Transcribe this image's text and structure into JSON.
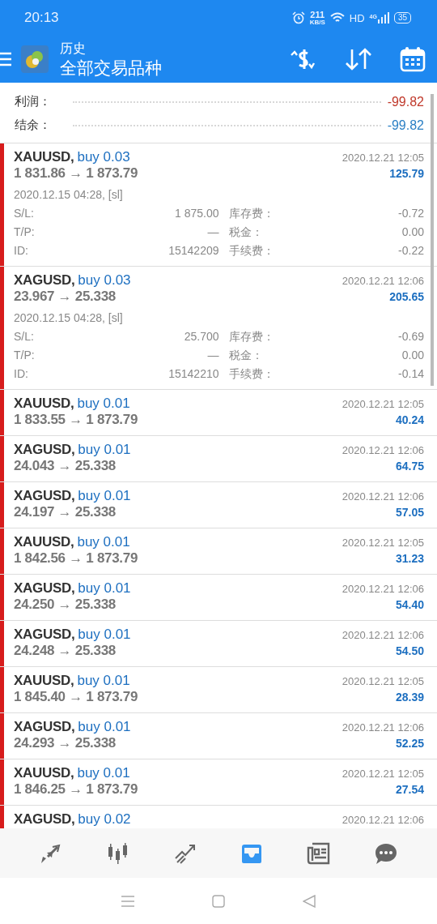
{
  "status_bar": {
    "time": "20:13",
    "speed": "211",
    "speed_unit": "KB/S",
    "hd": "HD",
    "network": "4G",
    "battery": "35"
  },
  "header": {
    "title": "历史",
    "subtitle": "全部交易品种"
  },
  "summary": [
    {
      "label": "利润：",
      "value": "-99.82",
      "color": "#c0392b"
    },
    {
      "label": "结余：",
      "value": "-99.82",
      "color": "#2a7fc4"
    }
  ],
  "trades": [
    {
      "symbol": "XAUUSD,",
      "action": "buy 0.03",
      "time": "2020.12.21 12:05",
      "prices": "1 831.86 → 1 873.79",
      "profit": "125.79",
      "open_info": "2020.12.15 04:28, [sl]",
      "details": [
        [
          "S/L:",
          "1 875.00",
          "库存费：",
          "-0.72"
        ],
        [
          "T/P:",
          "—",
          "税金：",
          "0.00"
        ],
        [
          "ID:",
          "15142209",
          "手续费：",
          "-0.22"
        ]
      ]
    },
    {
      "symbol": "XAGUSD,",
      "action": "buy 0.03",
      "time": "2020.12.21 12:06",
      "prices": "23.967 → 25.338",
      "profit": "205.65",
      "open_info": "2020.12.15 04:28, [sl]",
      "details": [
        [
          "S/L:",
          "25.700",
          "库存费：",
          "-0.69"
        ],
        [
          "T/P:",
          "—",
          "税金：",
          "0.00"
        ],
        [
          "ID:",
          "15142210",
          "手续费：",
          "-0.14"
        ]
      ]
    },
    {
      "symbol": "XAUUSD,",
      "action": "buy 0.01",
      "time": "2020.12.21 12:05",
      "prices": "1 833.55 → 1 873.79",
      "profit": "40.24"
    },
    {
      "symbol": "XAGUSD,",
      "action": "buy 0.01",
      "time": "2020.12.21 12:06",
      "prices": "24.043 → 25.338",
      "profit": "64.75"
    },
    {
      "symbol": "XAGUSD,",
      "action": "buy 0.01",
      "time": "2020.12.21 12:06",
      "prices": "24.197 → 25.338",
      "profit": "57.05"
    },
    {
      "symbol": "XAUUSD,",
      "action": "buy 0.01",
      "time": "2020.12.21 12:05",
      "prices": "1 842.56 → 1 873.79",
      "profit": "31.23"
    },
    {
      "symbol": "XAGUSD,",
      "action": "buy 0.01",
      "time": "2020.12.21 12:06",
      "prices": "24.250 → 25.338",
      "profit": "54.40"
    },
    {
      "symbol": "XAGUSD,",
      "action": "buy 0.01",
      "time": "2020.12.21 12:06",
      "prices": "24.248 → 25.338",
      "profit": "54.50"
    },
    {
      "symbol": "XAUUSD,",
      "action": "buy 0.01",
      "time": "2020.12.21 12:05",
      "prices": "1 845.40 → 1 873.79",
      "profit": "28.39"
    },
    {
      "symbol": "XAGUSD,",
      "action": "buy 0.01",
      "time": "2020.12.21 12:06",
      "prices": "24.293 → 25.338",
      "profit": "52.25"
    },
    {
      "symbol": "XAUUSD,",
      "action": "buy 0.01",
      "time": "2020.12.21 12:05",
      "prices": "1 846.25 → 1 873.79",
      "profit": "27.54"
    },
    {
      "symbol": "XAGUSD,",
      "action": "buy 0.02",
      "time": "2020.12.21 12:06"
    }
  ],
  "bottom_nav": [
    {
      "kind": "trade",
      "selected": false
    },
    {
      "kind": "quotes",
      "selected": false
    },
    {
      "kind": "chart",
      "selected": false
    },
    {
      "kind": "history",
      "selected": true
    },
    {
      "kind": "news",
      "selected": false
    },
    {
      "kind": "chat",
      "selected": false
    }
  ]
}
